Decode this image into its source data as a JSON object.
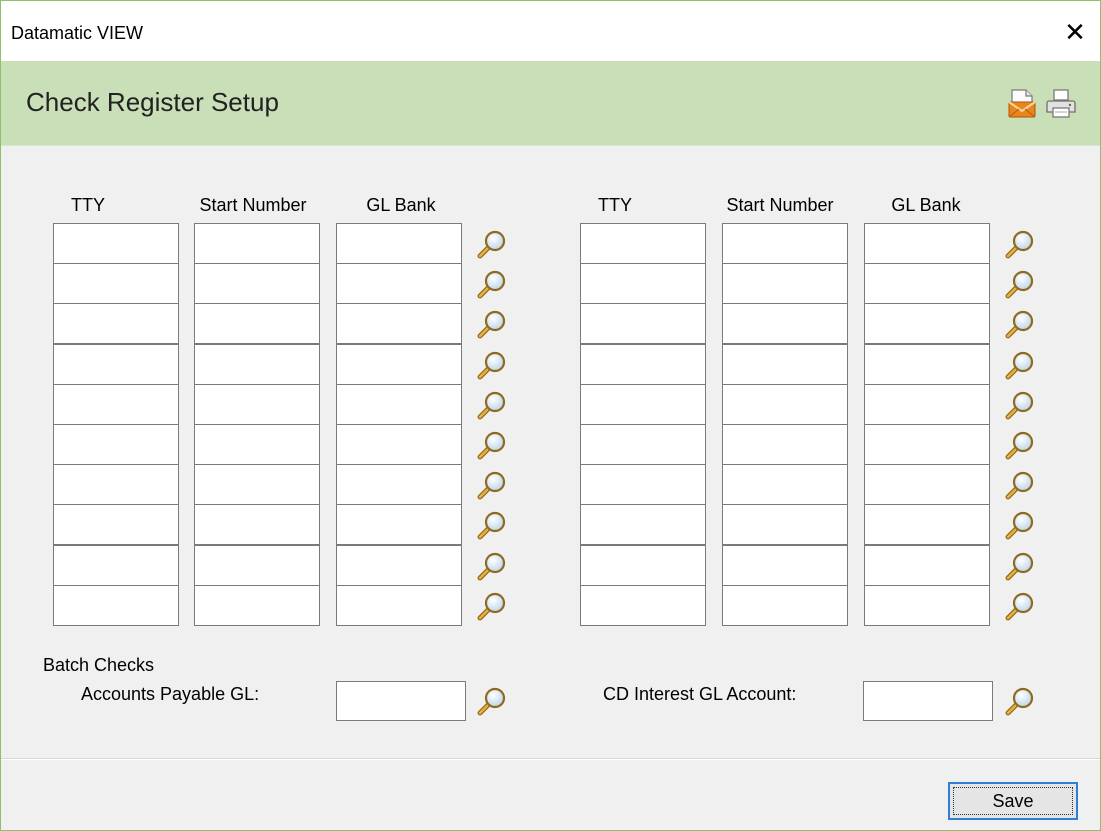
{
  "window": {
    "title": "Datamatic VIEW",
    "close_glyph": "✕"
  },
  "header": {
    "heading": "Check Register Setup",
    "icons": [
      "email-icon",
      "print-icon"
    ],
    "color": "#c8dfb8"
  },
  "grid": {
    "left": {
      "col_tty": "TTY",
      "col_start": "Start Number",
      "col_gl": "GL Bank",
      "rows": [
        {
          "tty": "",
          "start": "",
          "gl": ""
        },
        {
          "tty": "",
          "start": "",
          "gl": ""
        },
        {
          "tty": "",
          "start": "",
          "gl": ""
        },
        {
          "tty": "",
          "start": "",
          "gl": ""
        },
        {
          "tty": "",
          "start": "",
          "gl": ""
        },
        {
          "tty": "",
          "start": "",
          "gl": ""
        },
        {
          "tty": "",
          "start": "",
          "gl": ""
        },
        {
          "tty": "",
          "start": "",
          "gl": ""
        },
        {
          "tty": "",
          "start": "",
          "gl": ""
        },
        {
          "tty": "",
          "start": "",
          "gl": ""
        }
      ]
    },
    "right": {
      "col_tty": "TTY",
      "col_start": "Start Number",
      "col_gl": "GL Bank",
      "rows": [
        {
          "tty": "",
          "start": "",
          "gl": ""
        },
        {
          "tty": "",
          "start": "",
          "gl": ""
        },
        {
          "tty": "",
          "start": "",
          "gl": ""
        },
        {
          "tty": "",
          "start": "",
          "gl": ""
        },
        {
          "tty": "",
          "start": "",
          "gl": ""
        },
        {
          "tty": "",
          "start": "",
          "gl": ""
        },
        {
          "tty": "",
          "start": "",
          "gl": ""
        },
        {
          "tty": "",
          "start": "",
          "gl": ""
        },
        {
          "tty": "",
          "start": "",
          "gl": ""
        },
        {
          "tty": "",
          "start": "",
          "gl": ""
        }
      ]
    }
  },
  "bottom": {
    "batch_checks_label": "Batch Checks",
    "ap_gl_label": "Accounts Payable GL:",
    "ap_gl_value": "",
    "cd_interest_label": "CD Interest GL Account:",
    "cd_interest_value": ""
  },
  "footer": {
    "save_label": "Save",
    "focus_color": "#2f7fd3"
  }
}
